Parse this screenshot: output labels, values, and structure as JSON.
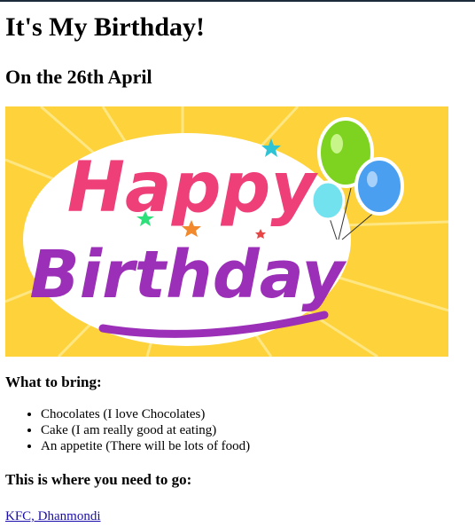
{
  "page": {
    "title": "It's My Birthday!",
    "date_heading": "On the 26th April",
    "banner": {
      "line1": "Happy",
      "line2": "Birthday",
      "bg": "#fdd23a"
    },
    "bring_heading": "What to bring:",
    "bring_items": [
      "Chocolates (I love Chocolates)",
      "Cake (I am really good at eating)",
      "An appetite (There will be lots of food)"
    ],
    "where_heading": "This is where you need to go:",
    "location_link": "KFC, Dhanmondi"
  }
}
